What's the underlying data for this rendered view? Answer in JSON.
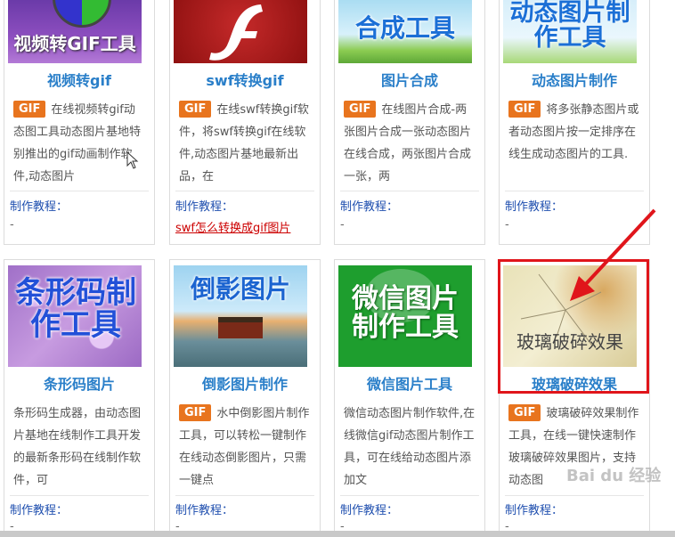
{
  "tutorial_label": "制作教程：",
  "gif_badge": "GIF",
  "row1": [
    {
      "thumb_text": "视频转GIF工具",
      "title": "视频转gif",
      "desc": "在线视频转gif动态图工具动态图片基地特别推出的gif动画制作软件,动态图片",
      "tutorial": "-"
    },
    {
      "title": "swf转换gif",
      "desc": "在线swf转换gif软件，将swf转换gif在线软件,动态图片基地最新出品，在",
      "tutorial_link": "swf怎么转换成gif图片"
    },
    {
      "thumb_text": "合成工具",
      "title": "图片合成",
      "desc": "在线图片合成-两张图片合成一张动态图片在线合成，两张图片合成一张，两",
      "tutorial": "-"
    },
    {
      "thumb_text": "动态图片制作工具",
      "title": "动态图片制作",
      "desc": "将多张静态图片或者动态图片按一定排序在线生成动态图片的工具.",
      "tutorial": "-"
    }
  ],
  "row2": [
    {
      "thumb_text": "条形码制作工具",
      "title": "条形码图片",
      "desc": "条形码生成器，由动态图片基地在线制作工具开发的最新条形码在线制作软件，可",
      "tutorial": "-"
    },
    {
      "thumb_text": "倒影图片",
      "title": "倒影图片制作",
      "desc": "水中倒影图片制作工具，可以转松一键制作在线动态倒影图片，只需一键点",
      "tutorial": "-"
    },
    {
      "thumb_text": "微信图片制作工具",
      "title": "微信图片工具",
      "desc": "微信动态图片制作软件,在线微信gif动态图片制作工具，可在线给动态图片添加文",
      "tutorial": "-"
    },
    {
      "thumb_text": "玻璃破碎效果",
      "title": "玻璃破碎效果",
      "desc": "玻璃破碎效果制作工具，在线一键快速制作玻璃破碎效果图片，支持动态图",
      "tutorial": "-"
    }
  ],
  "watermark": "Bai du 经验"
}
